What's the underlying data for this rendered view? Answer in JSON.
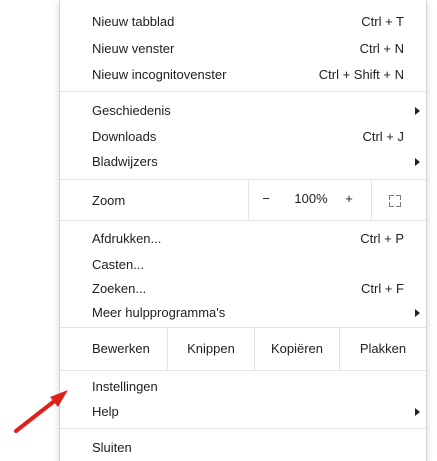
{
  "menu": {
    "items_top": [
      {
        "label": "Nieuw tabblad",
        "shortcut": "Ctrl + T"
      },
      {
        "label": "Nieuw venster",
        "shortcut": "Ctrl + N"
      },
      {
        "label": "Nieuw incognitovenster",
        "shortcut": "Ctrl + Shift + N"
      }
    ],
    "items_history": [
      {
        "label": "Geschiedenis",
        "shortcut": ""
      },
      {
        "label": "Downloads",
        "shortcut": "Ctrl + J"
      },
      {
        "label": "Bladwijzers",
        "shortcut": ""
      }
    ],
    "zoom": {
      "label": "Zoom",
      "minus": "−",
      "value": "100%",
      "plus": "+"
    },
    "items_tools": [
      {
        "label": "Afdrukken...",
        "shortcut": "Ctrl + P"
      },
      {
        "label": "Casten...",
        "shortcut": ""
      },
      {
        "label": "Zoeken...",
        "shortcut": "Ctrl + F"
      },
      {
        "label": "Meer hulpprogramma's",
        "shortcut": ""
      }
    ],
    "edit": {
      "label": "Bewerken",
      "cut": "Knippen",
      "copy": "Kopiëren",
      "paste": "Plakken"
    },
    "items_settings": [
      {
        "label": "Instellingen",
        "shortcut": ""
      },
      {
        "label": "Help",
        "shortcut": ""
      }
    ],
    "exit": {
      "label": "Sluiten"
    }
  },
  "colors": {
    "text": "#202124",
    "separator": "#e3e3e3",
    "arrow_annotation": "#e0201b"
  },
  "icons": {
    "submenu": "triangle-right",
    "fullscreen": "fullscreen-corners",
    "annotation": "red-arrow"
  }
}
